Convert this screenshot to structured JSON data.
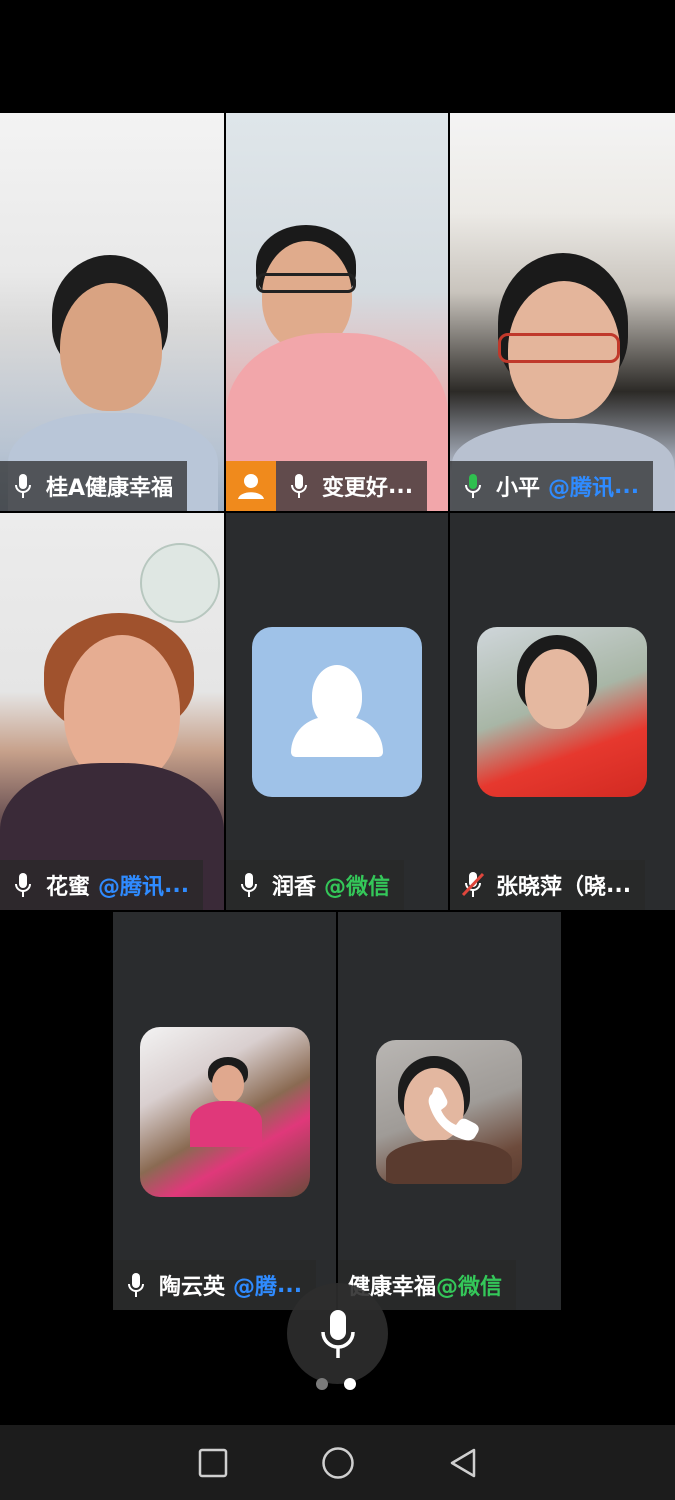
{
  "participants": [
    {
      "name": "桂A健康幸福",
      "source": "",
      "ellipsis": "",
      "mic": "on"
    },
    {
      "name": "变更好",
      "source": "",
      "ellipsis": "...",
      "mic": "on",
      "host": true
    },
    {
      "name": "小平",
      "source": "@腾讯",
      "ellipsis": "...",
      "mic": "on-active",
      "active": true
    },
    {
      "name": "花蜜",
      "source": "@腾讯",
      "ellipsis": "...",
      "mic": "on"
    },
    {
      "name": "润香",
      "source": "@微信",
      "ellipsis": "",
      "mic": "on"
    },
    {
      "name": "张晓萍（晓",
      "source": "",
      "ellipsis": "...",
      "mic": "muted"
    },
    {
      "name": "陶云英",
      "source": "@腾",
      "ellipsis": "...",
      "mic": "on"
    },
    {
      "name": "健康幸福",
      "source": "@微信",
      "ellipsis": "",
      "mic": "none",
      "calling": true
    }
  ],
  "colors": {
    "active_outline": "#2fbf4f",
    "tencent_source": "#2f8bff",
    "wechat_source": "#34c759",
    "host_badge": "#f08a1c",
    "default_avatar": "#9fc2e8"
  },
  "icons": {
    "microphone": "microphone-icon",
    "microphone_muted": "microphone-muted-icon",
    "host": "host-icon",
    "phone": "phone-call-icon",
    "nav_recent": "square-recent-apps-icon",
    "nav_home": "circle-home-icon",
    "nav_back": "triangle-back-icon"
  },
  "pager": {
    "pages": 2,
    "current_page": 2
  }
}
